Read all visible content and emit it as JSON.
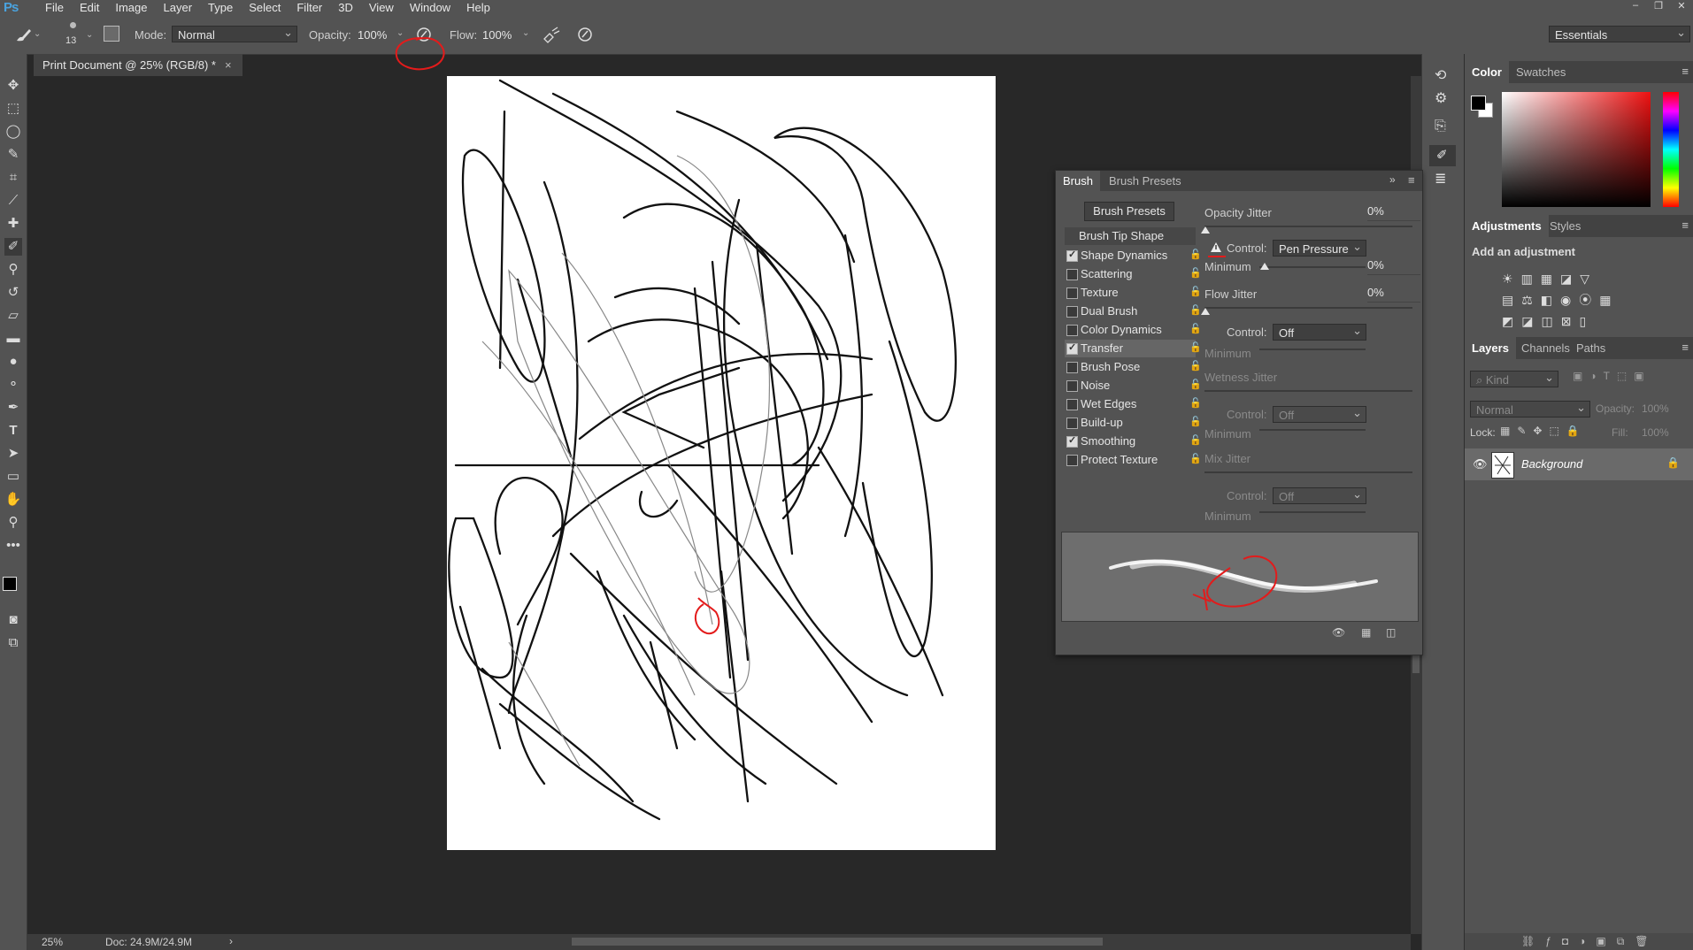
{
  "app": {
    "logo": "Ps",
    "accent": "#4aa3df"
  },
  "menu": [
    "File",
    "Edit",
    "Image",
    "Layer",
    "Type",
    "Select",
    "Filter",
    "3D",
    "View",
    "Window",
    "Help"
  ],
  "window_controls": [
    "–",
    "❐",
    "✕"
  ],
  "options": {
    "brush_size": "13",
    "mode_label": "Mode:",
    "mode_value": "Normal",
    "opacity_label": "Opacity:",
    "opacity_value": "100%",
    "flow_label": "Flow:",
    "flow_value": "100%",
    "workspace": "Essentials"
  },
  "document": {
    "tab_title": "Print Document @ 25% (RGB/8) *",
    "close": "×",
    "zoom": "25%",
    "doc_size": "Doc: 24.9M/24.9M",
    "status_arrow": "›"
  },
  "brush_panel": {
    "tabs": [
      "Brush",
      "Brush Presets"
    ],
    "presets_button": "Brush Presets",
    "tip_shape": "Brush Tip Shape",
    "options": [
      {
        "label": "Shape Dynamics",
        "checked": true
      },
      {
        "label": "Scattering",
        "checked": false
      },
      {
        "label": "Texture",
        "checked": false
      },
      {
        "label": "Dual Brush",
        "checked": false
      },
      {
        "label": "Color Dynamics",
        "checked": false
      },
      {
        "label": "Transfer",
        "checked": true,
        "selected": true
      },
      {
        "label": "Brush Pose",
        "checked": false
      },
      {
        "label": "Noise",
        "checked": false
      },
      {
        "label": "Wet Edges",
        "checked": false
      },
      {
        "label": "Build-up",
        "checked": false
      },
      {
        "label": "Smoothing",
        "checked": true
      },
      {
        "label": "Protect Texture",
        "checked": false
      }
    ],
    "opacity_jitter_label": "Opacity Jitter",
    "opacity_jitter_value": "0%",
    "control_label": "Control:",
    "control1_value": "Pen Pressure",
    "minimum_label": "Minimum",
    "minimum1_value": "0%",
    "flow_jitter_label": "Flow Jitter",
    "flow_jitter_value": "0%",
    "control2_value": "Off",
    "wetness_jitter_label": "Wetness Jitter",
    "control3_value": "Off",
    "mix_jitter_label": "Mix Jitter",
    "control4_value": "Off"
  },
  "color_panel": {
    "tabs": [
      "Color",
      "Swatches"
    ]
  },
  "adjustments_panel": {
    "tabs": [
      "Adjustments",
      "Styles"
    ],
    "heading": "Add an adjustment"
  },
  "layers_panel": {
    "tabs": [
      "Layers",
      "Channels",
      "Paths"
    ],
    "filter_kind": "Kind",
    "blend_mode": "Normal",
    "opacity_label": "Opacity:",
    "opacity_value": "100%",
    "lock_label": "Lock:",
    "fill_label": "Fill:",
    "fill_value": "100%",
    "layers": [
      {
        "name": "Background",
        "visible": true,
        "locked": true
      }
    ]
  },
  "annotation_color": "#e31b1b"
}
